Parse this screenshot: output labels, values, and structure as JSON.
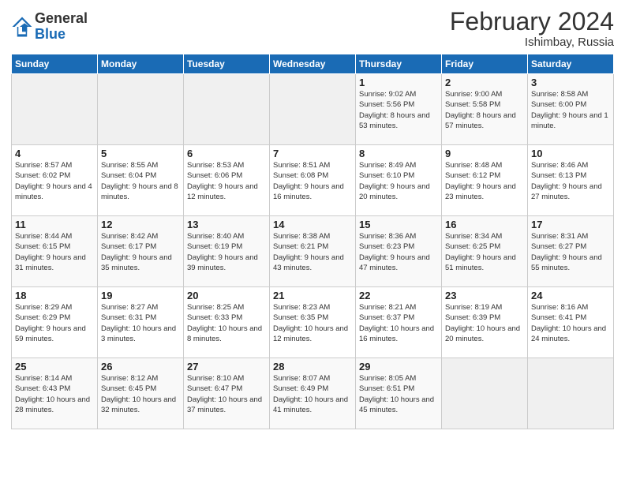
{
  "header": {
    "logo_general": "General",
    "logo_blue": "Blue",
    "title": "February 2024",
    "subtitle": "Ishimbay, Russia"
  },
  "weekdays": [
    "Sunday",
    "Monday",
    "Tuesday",
    "Wednesday",
    "Thursday",
    "Friday",
    "Saturday"
  ],
  "weeks": [
    [
      {
        "day": "",
        "info": ""
      },
      {
        "day": "",
        "info": ""
      },
      {
        "day": "",
        "info": ""
      },
      {
        "day": "",
        "info": ""
      },
      {
        "day": "1",
        "info": "Sunrise: 9:02 AM\nSunset: 5:56 PM\nDaylight: 8 hours\nand 53 minutes."
      },
      {
        "day": "2",
        "info": "Sunrise: 9:00 AM\nSunset: 5:58 PM\nDaylight: 8 hours\nand 57 minutes."
      },
      {
        "day": "3",
        "info": "Sunrise: 8:58 AM\nSunset: 6:00 PM\nDaylight: 9 hours\nand 1 minute."
      }
    ],
    [
      {
        "day": "4",
        "info": "Sunrise: 8:57 AM\nSunset: 6:02 PM\nDaylight: 9 hours\nand 4 minutes."
      },
      {
        "day": "5",
        "info": "Sunrise: 8:55 AM\nSunset: 6:04 PM\nDaylight: 9 hours\nand 8 minutes."
      },
      {
        "day": "6",
        "info": "Sunrise: 8:53 AM\nSunset: 6:06 PM\nDaylight: 9 hours\nand 12 minutes."
      },
      {
        "day": "7",
        "info": "Sunrise: 8:51 AM\nSunset: 6:08 PM\nDaylight: 9 hours\nand 16 minutes."
      },
      {
        "day": "8",
        "info": "Sunrise: 8:49 AM\nSunset: 6:10 PM\nDaylight: 9 hours\nand 20 minutes."
      },
      {
        "day": "9",
        "info": "Sunrise: 8:48 AM\nSunset: 6:12 PM\nDaylight: 9 hours\nand 23 minutes."
      },
      {
        "day": "10",
        "info": "Sunrise: 8:46 AM\nSunset: 6:13 PM\nDaylight: 9 hours\nand 27 minutes."
      }
    ],
    [
      {
        "day": "11",
        "info": "Sunrise: 8:44 AM\nSunset: 6:15 PM\nDaylight: 9 hours\nand 31 minutes."
      },
      {
        "day": "12",
        "info": "Sunrise: 8:42 AM\nSunset: 6:17 PM\nDaylight: 9 hours\nand 35 minutes."
      },
      {
        "day": "13",
        "info": "Sunrise: 8:40 AM\nSunset: 6:19 PM\nDaylight: 9 hours\nand 39 minutes."
      },
      {
        "day": "14",
        "info": "Sunrise: 8:38 AM\nSunset: 6:21 PM\nDaylight: 9 hours\nand 43 minutes."
      },
      {
        "day": "15",
        "info": "Sunrise: 8:36 AM\nSunset: 6:23 PM\nDaylight: 9 hours\nand 47 minutes."
      },
      {
        "day": "16",
        "info": "Sunrise: 8:34 AM\nSunset: 6:25 PM\nDaylight: 9 hours\nand 51 minutes."
      },
      {
        "day": "17",
        "info": "Sunrise: 8:31 AM\nSunset: 6:27 PM\nDaylight: 9 hours\nand 55 minutes."
      }
    ],
    [
      {
        "day": "18",
        "info": "Sunrise: 8:29 AM\nSunset: 6:29 PM\nDaylight: 9 hours\nand 59 minutes."
      },
      {
        "day": "19",
        "info": "Sunrise: 8:27 AM\nSunset: 6:31 PM\nDaylight: 10 hours\nand 3 minutes."
      },
      {
        "day": "20",
        "info": "Sunrise: 8:25 AM\nSunset: 6:33 PM\nDaylight: 10 hours\nand 8 minutes."
      },
      {
        "day": "21",
        "info": "Sunrise: 8:23 AM\nSunset: 6:35 PM\nDaylight: 10 hours\nand 12 minutes."
      },
      {
        "day": "22",
        "info": "Sunrise: 8:21 AM\nSunset: 6:37 PM\nDaylight: 10 hours\nand 16 minutes."
      },
      {
        "day": "23",
        "info": "Sunrise: 8:19 AM\nSunset: 6:39 PM\nDaylight: 10 hours\nand 20 minutes."
      },
      {
        "day": "24",
        "info": "Sunrise: 8:16 AM\nSunset: 6:41 PM\nDaylight: 10 hours\nand 24 minutes."
      }
    ],
    [
      {
        "day": "25",
        "info": "Sunrise: 8:14 AM\nSunset: 6:43 PM\nDaylight: 10 hours\nand 28 minutes."
      },
      {
        "day": "26",
        "info": "Sunrise: 8:12 AM\nSunset: 6:45 PM\nDaylight: 10 hours\nand 32 minutes."
      },
      {
        "day": "27",
        "info": "Sunrise: 8:10 AM\nSunset: 6:47 PM\nDaylight: 10 hours\nand 37 minutes."
      },
      {
        "day": "28",
        "info": "Sunrise: 8:07 AM\nSunset: 6:49 PM\nDaylight: 10 hours\nand 41 minutes."
      },
      {
        "day": "29",
        "info": "Sunrise: 8:05 AM\nSunset: 6:51 PM\nDaylight: 10 hours\nand 45 minutes."
      },
      {
        "day": "",
        "info": ""
      },
      {
        "day": "",
        "info": ""
      }
    ]
  ]
}
